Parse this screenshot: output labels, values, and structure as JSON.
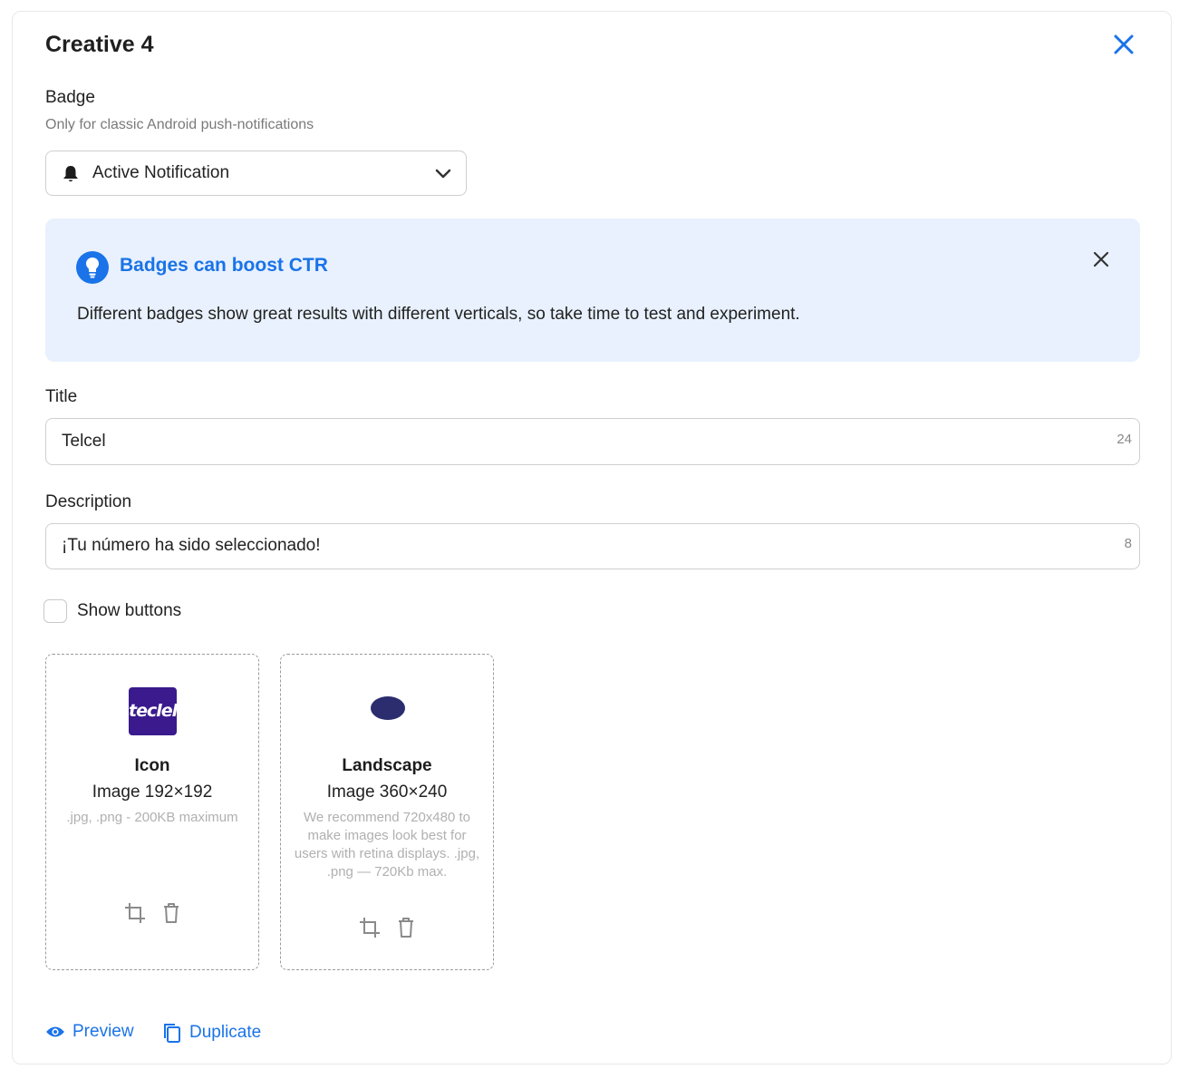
{
  "panel": {
    "title": "Creative 4"
  },
  "badge": {
    "label": "Badge",
    "sublabel": "Only for classic Android push-notifications",
    "selected": "Active Notification"
  },
  "tip": {
    "title": "Badges can boost CTR",
    "body": "Different badges show great results with different verticals, so take time to test and experiment."
  },
  "title_field": {
    "label": "Title",
    "value": "Telcel",
    "counter": "24"
  },
  "description_field": {
    "label": "Description",
    "value": "¡Tu número ha sido seleccionado!",
    "counter": "8"
  },
  "show_buttons": {
    "label": "Show buttons",
    "checked": false
  },
  "uploads": [
    {
      "name": "Icon",
      "dimensions": "Image 192×192",
      "hint": ".jpg, .png - 200KB maximum",
      "thumb_text": "teclel"
    },
    {
      "name": "Landscape",
      "dimensions": "Image 360×240",
      "hint": "We recommend 720x480 to make images look best for users with retina displays. .jpg, .png — 720Kb max."
    }
  ],
  "actions": {
    "preview": "Preview",
    "duplicate": "Duplicate"
  },
  "colors": {
    "accent": "#1a73e8",
    "tip_bg": "#e8f1fd",
    "icon_bg": "#3a1a8c"
  }
}
